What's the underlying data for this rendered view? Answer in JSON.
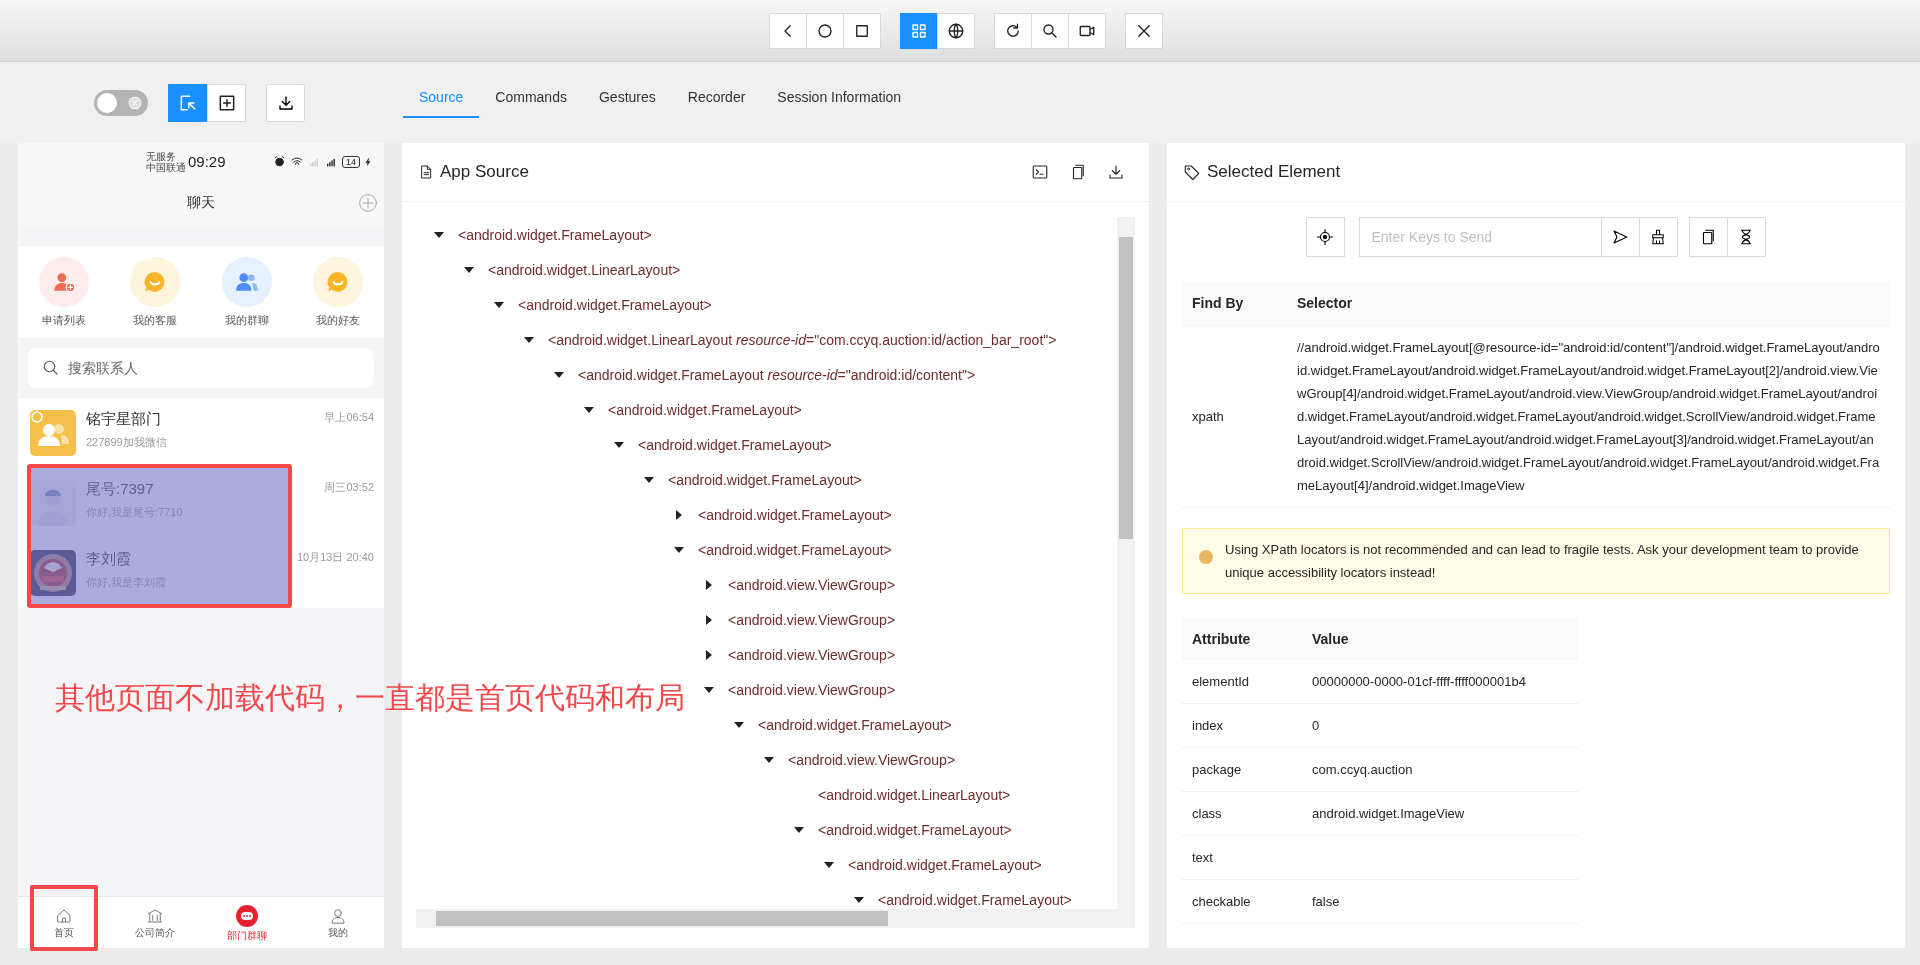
{
  "device_toolbar": {
    "groups": [
      [
        {
          "kind": "back",
          "selected": false
        },
        {
          "kind": "home",
          "selected": false
        },
        {
          "kind": "recents",
          "selected": false
        }
      ],
      [
        {
          "kind": "native",
          "selected": true
        },
        {
          "kind": "web",
          "selected": false
        }
      ],
      [
        {
          "kind": "refresh",
          "selected": false
        },
        {
          "kind": "search",
          "selected": false
        },
        {
          "kind": "record",
          "selected": false
        }
      ],
      [
        {
          "kind": "quit",
          "selected": false
        }
      ]
    ]
  },
  "inspector_controls": {
    "screenshot_toggle": {
      "on": false
    },
    "modes": [
      {
        "kind": "select",
        "selected": true
      },
      {
        "kind": "tap",
        "selected": false
      }
    ]
  },
  "tabs": [
    {
      "label": "Source",
      "selected": true
    },
    {
      "label": "Commands",
      "selected": false
    },
    {
      "label": "Gestures",
      "selected": false
    },
    {
      "label": "Recorder",
      "selected": false
    },
    {
      "label": "Session Information",
      "selected": false
    }
  ],
  "phone": {
    "status_bar": {
      "carrier_top": "无服务",
      "carrier_bottom": "中国联通",
      "time": "09:29",
      "battery": "14"
    },
    "title": "聊天",
    "shortcuts": [
      {
        "kind": "apply",
        "label": "申请列表"
      },
      {
        "kind": "service",
        "label": "我的客服"
      },
      {
        "kind": "groups",
        "label": "我的群聊"
      },
      {
        "kind": "friends",
        "label": "我的好友"
      }
    ],
    "search": {
      "placeholder": "搜索联系人"
    },
    "chats": [
      {
        "kind": "group",
        "name": "铭宇星部门",
        "message": "227899加我微信",
        "time": "早上06:54",
        "highlighted": false
      },
      {
        "kind": "person",
        "name": "尾号:7397",
        "message": "你好,我是尾号:7710",
        "time": "周三03:52",
        "highlighted": true
      },
      {
        "kind": "picture",
        "name": "李刘霞",
        "message": "你好,我是李刘霞",
        "time": "10月13日 20:40",
        "highlighted": true
      }
    ],
    "nav": [
      {
        "kind": "home",
        "label": "首页",
        "selected": false,
        "annotated": true
      },
      {
        "kind": "company",
        "label": "公司简介",
        "selected": false,
        "annotated": false
      },
      {
        "kind": "chat",
        "label": "部门群聊",
        "selected": true,
        "annotated": false
      },
      {
        "kind": "me",
        "label": "我的",
        "selected": false,
        "annotated": false
      }
    ]
  },
  "annotation_note": "其他页面不加载代码，一直都是首页代码和布局",
  "app_source": {
    "title": "App Source",
    "tree": [
      {
        "label": "<android.widget.FrameLayout>",
        "expanded": true,
        "children": [
          {
            "label": "<android.widget.LinearLayout>",
            "expanded": true,
            "children": [
              {
                "label": "<android.widget.FrameLayout>",
                "expanded": true,
                "children": [
                  {
                    "label": "<android.widget.LinearLayout *resource-id*=\"com.ccyq.auction:id/action_bar_root\">",
                    "expanded": true,
                    "children": [
                      {
                        "label": "<android.widget.FrameLayout *resource-id*=\"android:id/content\">",
                        "expanded": true,
                        "children": [
                          {
                            "label": "<android.widget.FrameLayout>",
                            "expanded": true,
                            "children": [
                              {
                                "label": "<android.widget.FrameLayout>",
                                "expanded": true,
                                "children": [
                                  {
                                    "label": "<android.widget.FrameLayout>",
                                    "expanded": true,
                                    "children": [
                                      {
                                        "label": "<android.widget.FrameLayout>",
                                        "expanded": false
                                      },
                                      {
                                        "label": "<android.widget.FrameLayout>",
                                        "expanded": true,
                                        "children": [
                                          {
                                            "label": "<android.view.ViewGroup>",
                                            "expanded": false
                                          },
                                          {
                                            "label": "<android.view.ViewGroup>",
                                            "expanded": false
                                          },
                                          {
                                            "label": "<android.view.ViewGroup>",
                                            "expanded": false
                                          },
                                          {
                                            "label": "<android.view.ViewGroup>",
                                            "expanded": true,
                                            "children": [
                                              {
                                                "label": "<android.widget.FrameLayout>",
                                                "expanded": true,
                                                "children": [
                                                  {
                                                    "label": "<android.view.ViewGroup>",
                                                    "expanded": true,
                                                    "children": [
                                                      {
                                                        "label": "<android.widget.LinearLayout>"
                                                      },
                                                      {
                                                        "label": "<android.widget.FrameLayout>",
                                                        "expanded": true,
                                                        "children": [
                                                          {
                                                            "label": "<android.widget.FrameLayout>",
                                                            "expanded": true,
                                                            "children": [
                                                              {
                                                                "label": "<android.widget.FrameLayout>",
                                                                "expanded": true
                                                              }
                                                            ]
                                                          }
                                                        ]
                                                      }
                                                    ]
                                                  }
                                                ]
                                              }
                                            ]
                                          }
                                        ]
                                      }
                                    ]
                                  }
                                ]
                              }
                            ]
                          }
                        ]
                      }
                    ]
                  }
                ]
              }
            ]
          }
        ]
      }
    ]
  },
  "selected_element": {
    "title": "Selected Element",
    "keys_placeholder": "Enter Keys to Send",
    "find_by": {
      "columns": [
        "Find By",
        "Selector"
      ],
      "rows": [
        {
          "strategy": "xpath",
          "selector": "//android.widget.FrameLayout[@resource-id=\"android:id/content\"]/android.widget.FrameLayout/android.widget.FrameLayout/android.widget.FrameLayout/android.widget.FrameLayout[2]/android.view.ViewGroup[4]/android.widget.FrameLayout/android.view.ViewGroup/android.widget.FrameLayout/android.widget.FrameLayout/android.widget.FrameLayout/android.widget.ScrollView/android.widget.FrameLayout/android.widget.FrameLayout/android.widget.FrameLayout[3]/android.widget.FrameLayout/android.widget.ScrollView/android.widget.FrameLayout/android.widget.FrameLayout/android.widget.FrameLayout[4]/android.widget.ImageView"
        }
      ]
    },
    "warning": "Using XPath locators is not recommended and can lead to fragile tests. Ask your development team to provide unique accessibility locators instead!",
    "attributes": {
      "columns": [
        "Attribute",
        "Value"
      ],
      "rows": [
        {
          "name": "elementId",
          "value": "00000000-0000-01cf-ffff-ffff000001b4"
        },
        {
          "name": "index",
          "value": "0"
        },
        {
          "name": "package",
          "value": "com.ccyq.auction"
        },
        {
          "name": "class",
          "value": "android.widget.ImageView"
        },
        {
          "name": "text"
        },
        {
          "name": "checkable",
          "value": "false"
        }
      ]
    }
  }
}
